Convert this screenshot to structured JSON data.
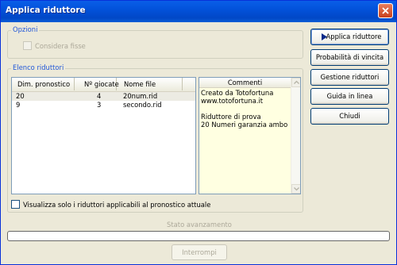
{
  "window": {
    "title": "Applica riduttore"
  },
  "options": {
    "legend": "Opzioni",
    "consider_fixed_label": "Considera fisse",
    "consider_fixed_checked": false
  },
  "reducers": {
    "legend": "Elenco riduttori",
    "columns": [
      "Dim. pronostico",
      "Nº giocate",
      "Nome file"
    ],
    "rows": [
      {
        "dim": "20",
        "giocate": "4",
        "file": "20num.rid"
      },
      {
        "dim": "9",
        "giocate": "3",
        "file": "secondo.rid"
      }
    ],
    "comments_header": "Commenti",
    "comments_lines": [
      "Creato da Totofortuna",
      "www.totofortuna.it",
      "",
      "Riduttore di prova",
      "20 Numeri garanzia ambo"
    ],
    "show_applicable_label": "Visualizza solo i riduttori applicabili al pronostico attuale",
    "show_applicable_checked": false
  },
  "buttons": {
    "apply": "Applica riduttore",
    "probability": "Probabilità di vincita",
    "manage": "Gestione riduttori",
    "guide": "Guida in linea",
    "close": "Chiudi"
  },
  "status": {
    "label": "Stato avanzamento",
    "progress": 0,
    "interrupt_label": "Interrompi"
  },
  "colors": {
    "title_bar": "#0252da",
    "legend_text": "#2157d8",
    "memo_background": "#ffffe1",
    "window_background": "#ece9d8"
  }
}
